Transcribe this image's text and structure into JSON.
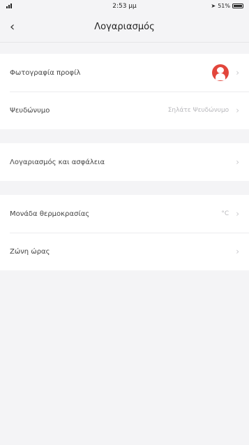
{
  "status_bar": {
    "time": "2:53 μμ",
    "battery_text": "51%"
  },
  "nav": {
    "title": "Λογαριασμός",
    "back_icon": "chevron-left-icon"
  },
  "groups": [
    {
      "rows": [
        {
          "label": "Φωτογραφία προφίλ",
          "value": "",
          "has_avatar": true
        },
        {
          "label": "Ψευδώνυμο",
          "value": "Σηλάτε Ψευδώνυμο"
        }
      ]
    },
    {
      "rows": [
        {
          "label": "Λογαριασμός και ασφάλεια",
          "value": ""
        }
      ]
    },
    {
      "rows": [
        {
          "label": "Μονάδα θερμοκρασίας",
          "value": "°C"
        },
        {
          "label": "Ζώνη ώρας",
          "value": ""
        }
      ]
    }
  ],
  "colors": {
    "background": "#f4f4f6",
    "card": "#ffffff",
    "avatar": "#e2463c",
    "value_text": "#b8b8bc"
  }
}
